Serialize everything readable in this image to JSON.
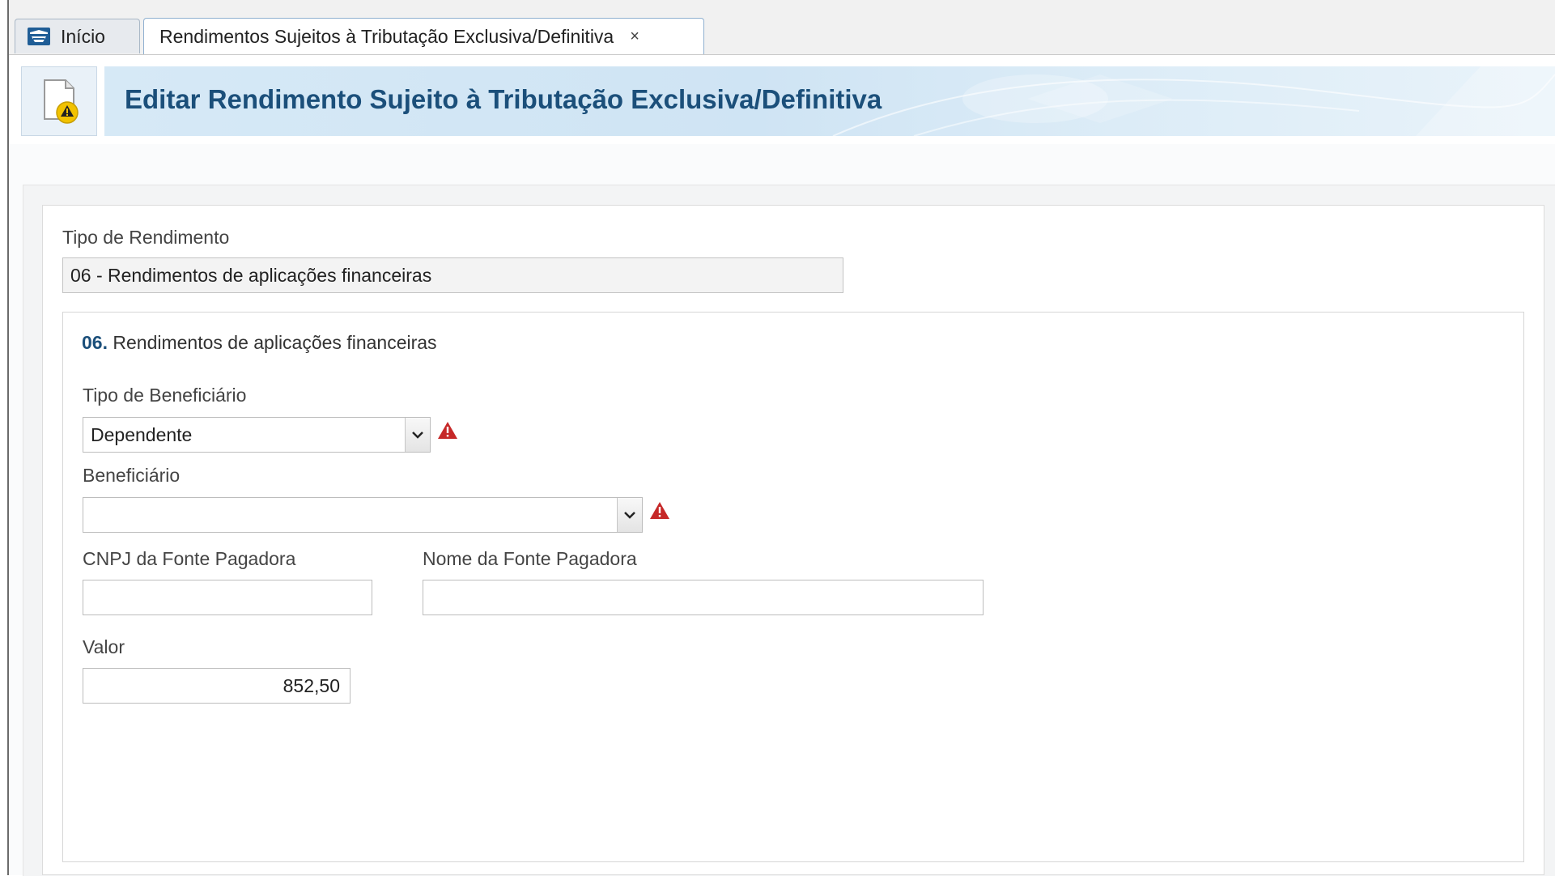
{
  "tabs": {
    "home_label": "Início",
    "active_label": "Rendimentos Sujeitos à Tributação Exclusiva/Definitiva",
    "close_symbol": "×"
  },
  "header": {
    "title": "Editar Rendimento Sujeito à Tributação Exclusiva/Definitiva",
    "icon": "document-warning-icon"
  },
  "form": {
    "tipo_rendimento": {
      "label": "Tipo de Rendimento",
      "value": "06 - Rendimentos de aplicações financeiras"
    },
    "section": {
      "code": "06.",
      "title": "Rendimentos de aplicações financeiras"
    },
    "tipo_beneficiario": {
      "label": "Tipo de Beneficiário",
      "value": "Dependente"
    },
    "beneficiario": {
      "label": "Beneficiário",
      "value": ""
    },
    "cnpj": {
      "label": "CNPJ da Fonte Pagadora",
      "value": ""
    },
    "nome_fonte": {
      "label": "Nome da Fonte Pagadora",
      "value": ""
    },
    "valor": {
      "label": "Valor",
      "value": "852,50"
    }
  },
  "colors": {
    "title_blue": "#1b4f7a",
    "warning_red": "#c62828",
    "warning_yellow": "#f2c200"
  }
}
